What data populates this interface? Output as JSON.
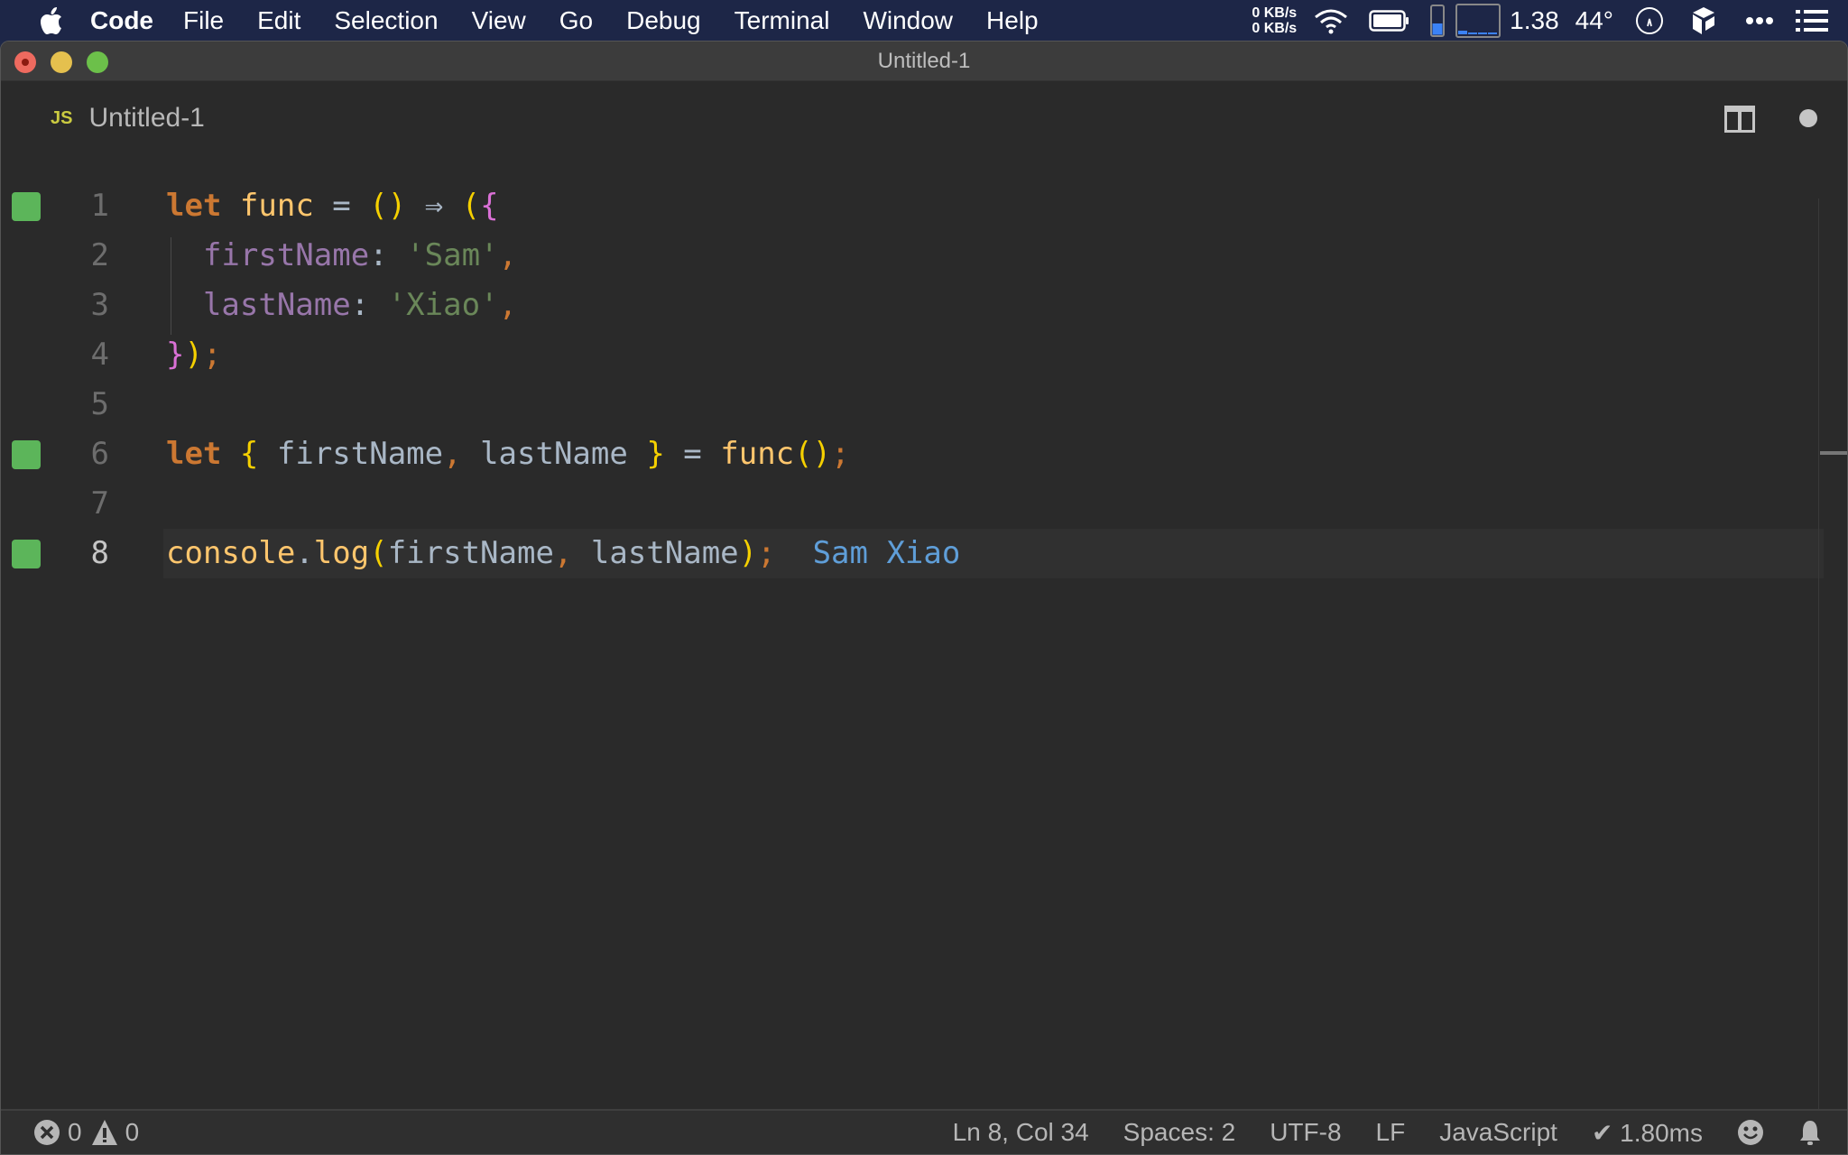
{
  "menubar": {
    "app_name": "Code",
    "items": [
      "File",
      "Edit",
      "Selection",
      "View",
      "Go",
      "Debug",
      "Terminal",
      "Window",
      "Help"
    ],
    "net_up": "0 KB/s",
    "net_down": "0 KB/s",
    "load": "1.38",
    "temperature": "44°",
    "battery_level": 0.9
  },
  "window": {
    "title": "Untitled-1"
  },
  "tab": {
    "badge": "JS",
    "label": "Untitled-1"
  },
  "editor": {
    "lines": [
      {
        "number": "1",
        "modified": true
      },
      {
        "number": "2",
        "modified": false
      },
      {
        "number": "3",
        "modified": false
      },
      {
        "number": "4",
        "modified": false
      },
      {
        "number": "5",
        "modified": false
      },
      {
        "number": "6",
        "modified": true
      },
      {
        "number": "7",
        "modified": false
      },
      {
        "number": "8",
        "modified": true
      }
    ],
    "tokens": {
      "let": "let",
      "func": "func",
      "eq": "=",
      "lparen": "(",
      "rparen": ")",
      "arrow": "⇒",
      "lbrace": "{",
      "rbrace": "}",
      "semi": ";",
      "comma": ",",
      "colon": ":",
      "firstName": "firstName",
      "lastName": "lastName",
      "str_sam": "'Sam'",
      "str_xiao": "'Xiao'",
      "console": "console",
      "dot": ".",
      "log": "log"
    },
    "inline_result": "Sam Xiao"
  },
  "statusbar": {
    "errors": "0",
    "warnings": "0",
    "cursor": "Ln 8, Col 34",
    "indent": "Spaces: 2",
    "encoding": "UTF-8",
    "eol": "LF",
    "language": "JavaScript",
    "timing": "✔ 1.80ms"
  }
}
